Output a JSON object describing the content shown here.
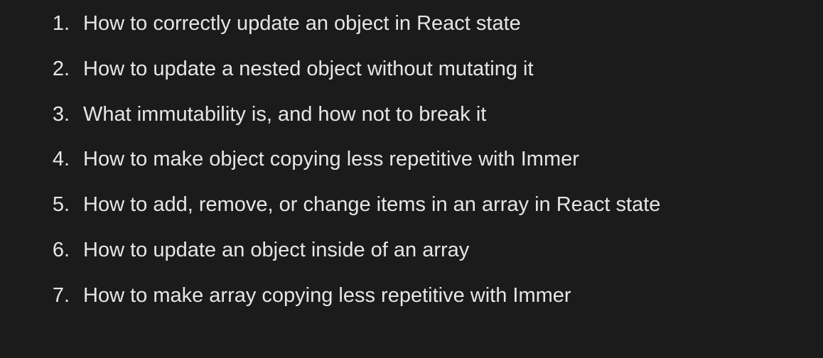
{
  "list": {
    "items": [
      {
        "number": "1.",
        "text": "How to correctly update an object in React state"
      },
      {
        "number": "2.",
        "text": "How to update a nested object without mutating it"
      },
      {
        "number": "3.",
        "text": "What immutability is, and how not to break it"
      },
      {
        "number": "4.",
        "text": "How to make object copying less repetitive with Immer"
      },
      {
        "number": "5.",
        "text": "How to add, remove, or change items in an array in React state"
      },
      {
        "number": "6.",
        "text": "How to update an object inside of an array"
      },
      {
        "number": "7.",
        "text": "How to make array copying less repetitive with Immer"
      }
    ]
  },
  "colors": {
    "background": "#1b1b1b",
    "text": "#e6e6e6"
  }
}
